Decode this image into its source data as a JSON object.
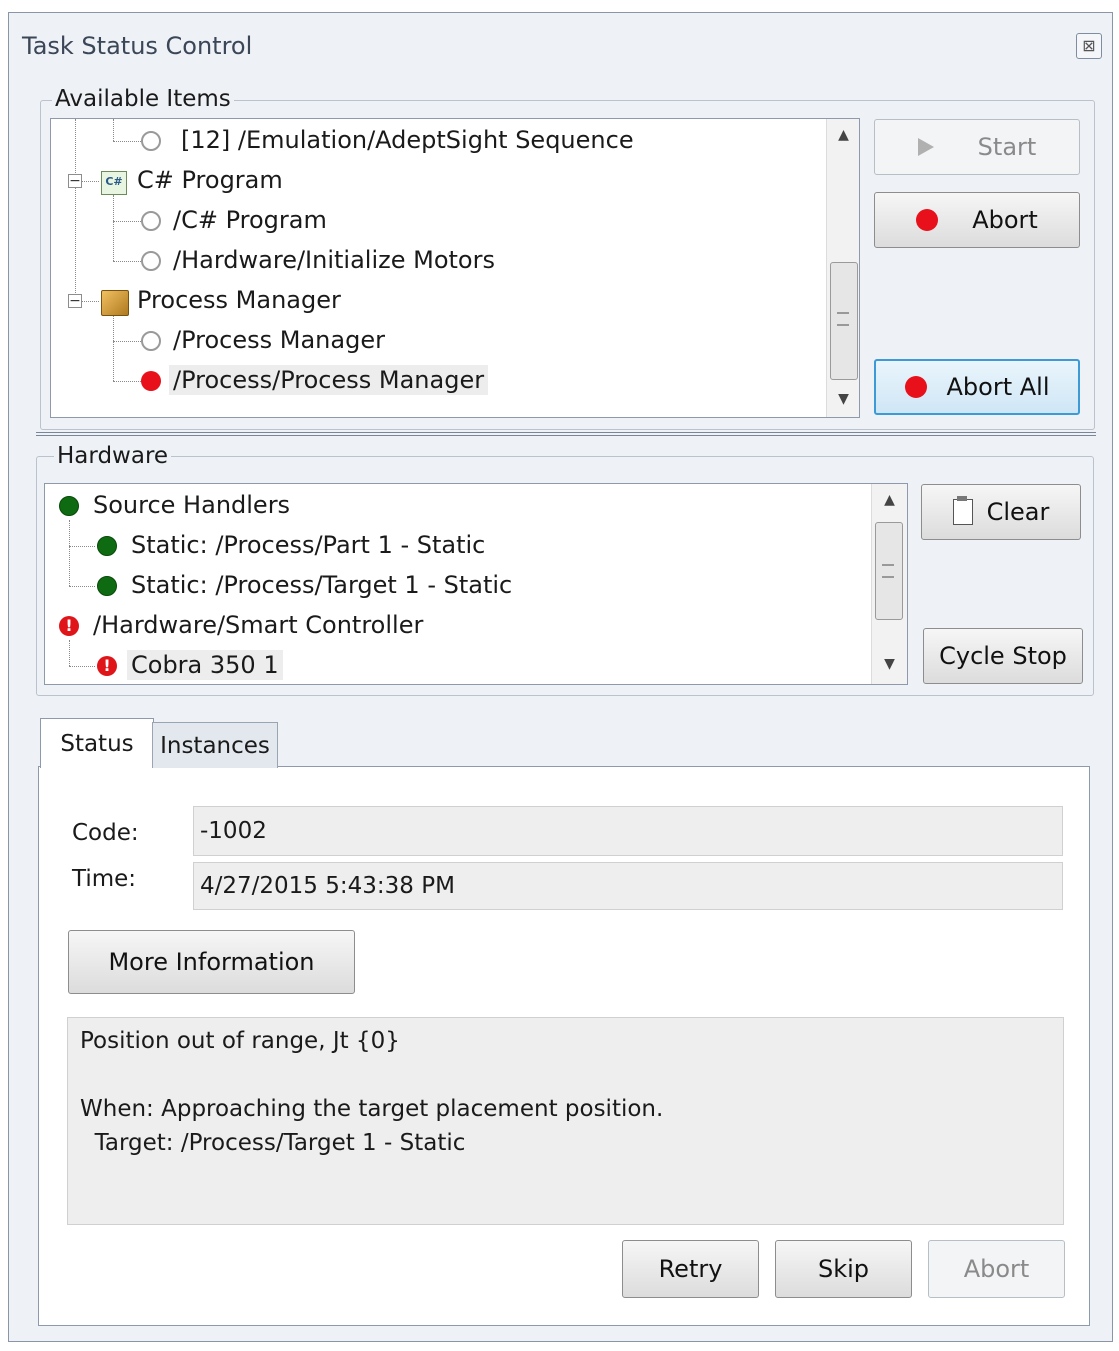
{
  "window": {
    "title": "Task Status Control",
    "close_glyph": "⊠"
  },
  "available_items": {
    "legend": "Available Items",
    "nodes": [
      {
        "label": "[12] /Emulation/AdeptSight Sequence",
        "status": "idle"
      },
      {
        "label": "C# Program",
        "icon": "csharp-icon"
      },
      {
        "label": "/C# Program",
        "status": "idle"
      },
      {
        "label": "/Hardware/Initialize Motors",
        "status": "idle"
      },
      {
        "label": "Process Manager",
        "icon": "package-icon"
      },
      {
        "label": "/Process Manager",
        "status": "idle"
      },
      {
        "label": "/Process/Process Manager",
        "status": "error",
        "selected": true
      }
    ],
    "buttons": {
      "start": "Start",
      "abort": "Abort",
      "abort_all": "Abort All"
    }
  },
  "hardware": {
    "legend": "Hardware",
    "nodes": [
      {
        "label": "Source Handlers",
        "status": "ok"
      },
      {
        "label": "Static: /Process/Part 1 - Static",
        "status": "ok"
      },
      {
        "label": "Static: /Process/Target 1 - Static",
        "status": "ok"
      },
      {
        "label": "/Hardware/Smart Controller",
        "status": "error"
      },
      {
        "label": "Cobra 350 1",
        "status": "error",
        "selected": true
      }
    ],
    "error_glyph": "!",
    "buttons": {
      "clear": "Clear",
      "cycle_stop": "Cycle Stop"
    }
  },
  "tabs": [
    {
      "label": "Status",
      "active": true
    },
    {
      "label": "Instances",
      "active": false
    }
  ],
  "status": {
    "code_label": "Code:",
    "code_value": "-1002",
    "time_label": "Time:",
    "time_value": "4/27/2015 5:43:38 PM",
    "more_info_button": "More Information",
    "message": "Position out of range, Jt {0}\n\nWhen: Approaching the target placement position.\n  Target: /Process/Target 1 - Static",
    "buttons": {
      "retry": "Retry",
      "skip": "Skip",
      "abort": "Abort"
    }
  }
}
